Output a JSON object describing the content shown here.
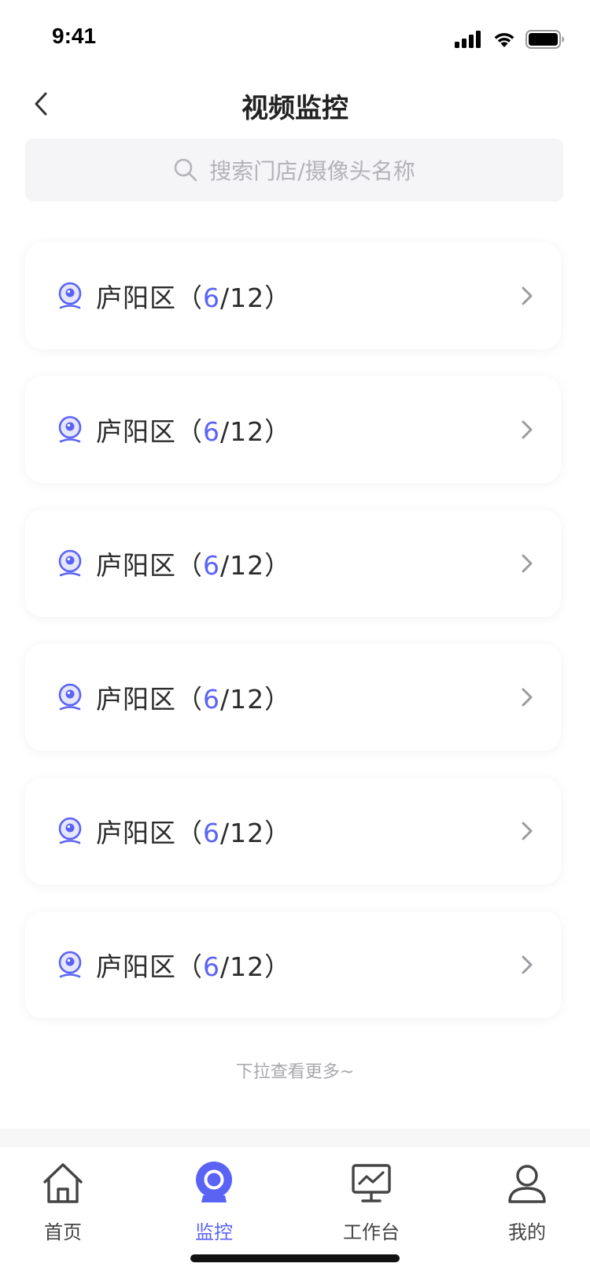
{
  "status_bar": {
    "time": "9:41"
  },
  "nav": {
    "title": "视频监控"
  },
  "search": {
    "placeholder": "搜索门店/摄像头名称"
  },
  "colors": {
    "accent": "#5b63f5",
    "text": "#2b2b2b",
    "muted": "#a8a8ad"
  },
  "regions": [
    {
      "name": "庐阳区",
      "online": "6",
      "total": "12"
    },
    {
      "name": "庐阳区",
      "online": "6",
      "total": "12"
    },
    {
      "name": "庐阳区",
      "online": "6",
      "total": "12"
    },
    {
      "name": "庐阳区",
      "online": "6",
      "total": "12"
    },
    {
      "name": "庐阳区",
      "online": "6",
      "total": "12"
    },
    {
      "name": "庐阳区",
      "online": "6",
      "total": "12"
    }
  ],
  "more_hint": "下拉查看更多~",
  "tabs": [
    {
      "label": "首页",
      "icon": "home-icon",
      "active": false
    },
    {
      "label": "监控",
      "icon": "camera-icon",
      "active": true
    },
    {
      "label": "工作台",
      "icon": "monitor-chart-icon",
      "active": false
    },
    {
      "label": "我的",
      "icon": "user-icon",
      "active": false
    }
  ]
}
